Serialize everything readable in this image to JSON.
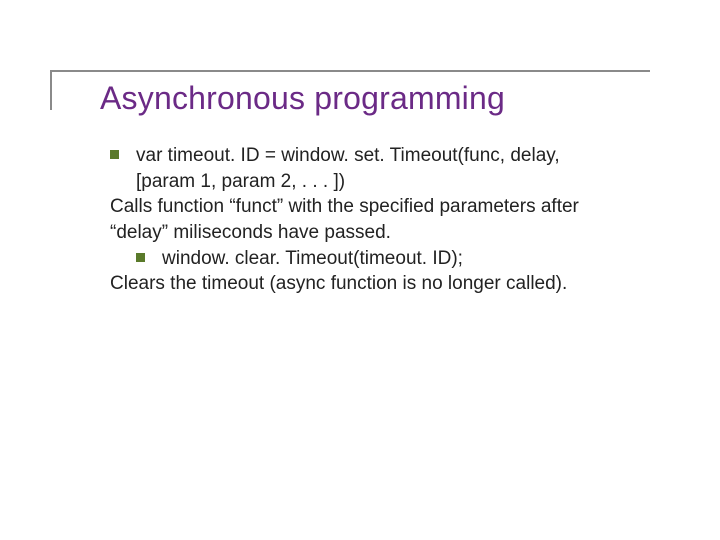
{
  "title": "Asynchronous programming",
  "body": {
    "item1_line1": "var timeout. ID = window. set. Timeout(func, delay,",
    "item1_line2": "[param 1, param 2, . . . ])",
    "desc1_line1": "Calls function “funct” with the specified parameters after",
    "desc1_line2": "“delay” miliseconds have passed.",
    "item2_line1": "window. clear. Timeout(timeout. ID);",
    "desc2_line1": "Clears the timeout (async function is no longer called)."
  }
}
